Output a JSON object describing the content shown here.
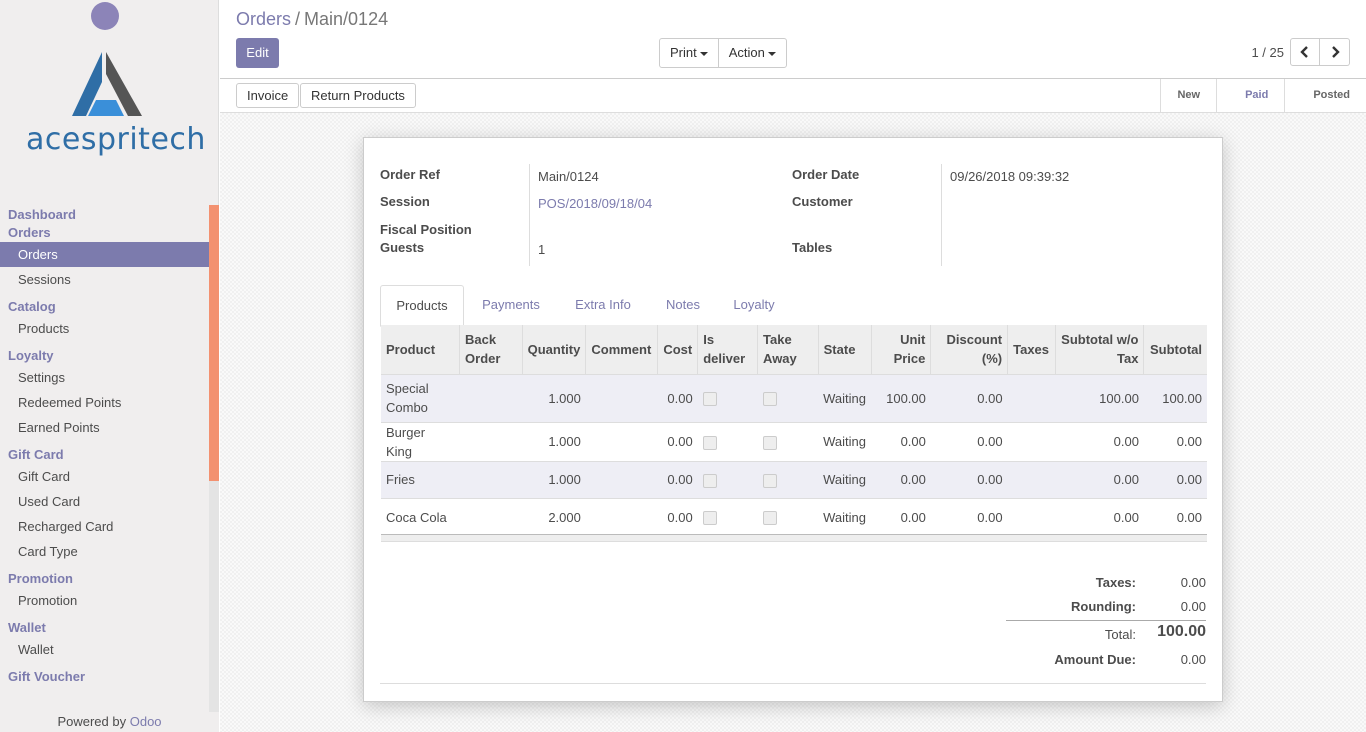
{
  "sidebar": {
    "brand": "acespritech",
    "sections": [
      {
        "label": "Dashboard",
        "items": []
      },
      {
        "label": "Orders",
        "items": [
          "Orders",
          "Sessions"
        ]
      },
      {
        "label": "Catalog",
        "items": [
          "Products"
        ]
      },
      {
        "label": "Loyalty",
        "items": [
          "Settings",
          "Redeemed Points",
          "Earned Points"
        ]
      },
      {
        "label": "Gift Card",
        "items": [
          "Gift Card",
          "Used Card",
          "Recharged Card",
          "Card Type"
        ]
      },
      {
        "label": "Promotion",
        "items": [
          "Promotion"
        ]
      },
      {
        "label": "Wallet",
        "items": [
          "Wallet"
        ]
      },
      {
        "label": "Gift Voucher",
        "items": []
      }
    ],
    "active_item": "Orders",
    "powered_by": "Powered by",
    "powered_brand": "Odoo"
  },
  "header": {
    "breadcrumb_parent": "Orders",
    "breadcrumb_sep": "/",
    "breadcrumb_current": "Main/0124",
    "edit_label": "Edit",
    "print_label": "Print",
    "action_label": "Action",
    "pager_value": "1 / 25"
  },
  "statusbar": {
    "buttons": [
      "Invoice",
      "Return Products"
    ],
    "stages": [
      "New",
      "Paid",
      "Posted"
    ],
    "active_stage": "Paid"
  },
  "form": {
    "order_ref_label": "Order Ref",
    "order_ref": "Main/0124",
    "session_label": "Session",
    "session": "POS/2018/09/18/04",
    "fiscal_label": "Fiscal Position",
    "guests_label": "Guests",
    "guests": "1",
    "order_date_label": "Order Date",
    "order_date": "09/26/2018 09:39:32",
    "customer_label": "Customer",
    "tables_label": "Tables"
  },
  "tabs": [
    "Products",
    "Payments",
    "Extra Info",
    "Notes",
    "Loyalty"
  ],
  "active_tab": "Products",
  "lines": {
    "columns": [
      "Product",
      "Back Order",
      "Quantity",
      "Comment",
      "Cost",
      "Is deliver",
      "Take Away",
      "State",
      "Unit Price",
      "Discount (%)",
      "Taxes",
      "Subtotal w/o Tax",
      "Subtotal"
    ],
    "rows": [
      {
        "product": "Special Combo",
        "back_order": "",
        "quantity": "1.000",
        "comment": "",
        "cost": "0.00",
        "state": "Waiting",
        "unit_price": "100.00",
        "discount": "0.00",
        "taxes": "",
        "subtotal_wo_tax": "100.00",
        "subtotal": "100.00"
      },
      {
        "product": "Burger King",
        "back_order": "",
        "quantity": "1.000",
        "comment": "",
        "cost": "0.00",
        "state": "Waiting",
        "unit_price": "0.00",
        "discount": "0.00",
        "taxes": "",
        "subtotal_wo_tax": "0.00",
        "subtotal": "0.00"
      },
      {
        "product": "Fries",
        "back_order": "",
        "quantity": "1.000",
        "comment": "",
        "cost": "0.00",
        "state": "Waiting",
        "unit_price": "0.00",
        "discount": "0.00",
        "taxes": "",
        "subtotal_wo_tax": "0.00",
        "subtotal": "0.00"
      },
      {
        "product": "Coca Cola",
        "back_order": "",
        "quantity": "2.000",
        "comment": "",
        "cost": "0.00",
        "state": "Waiting",
        "unit_price": "0.00",
        "discount": "0.00",
        "taxes": "",
        "subtotal_wo_tax": "0.00",
        "subtotal": "0.00"
      }
    ]
  },
  "totals": {
    "taxes_label": "Taxes:",
    "taxes": "0.00",
    "rounding_label": "Rounding:",
    "rounding": "0.00",
    "total_label": "Total:",
    "total": "100.00",
    "amount_due_label": "Amount Due:",
    "amount_due": "0.00"
  }
}
